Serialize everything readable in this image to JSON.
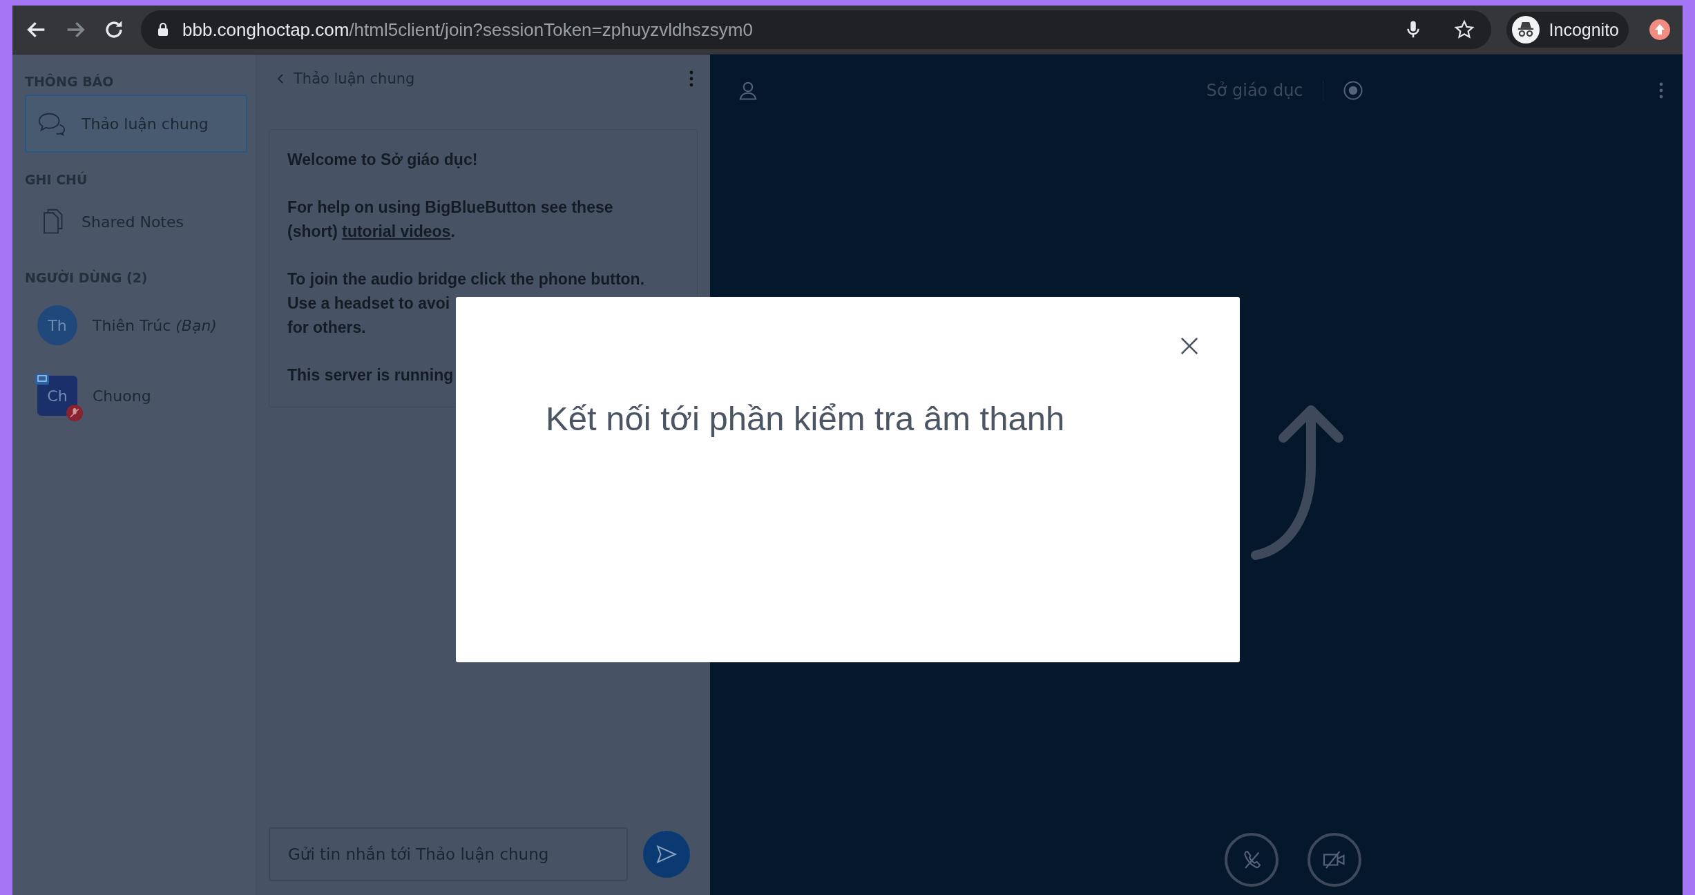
{
  "browser": {
    "url_host": "bbb.conghoctap.com",
    "url_path": "/html5client/join?sessionToken=zphuyzvldhszsym0",
    "profile": "Incognito"
  },
  "sidebar": {
    "sections": [
      {
        "title": "THÔNG BÁO",
        "items": [
          {
            "kind": "chat",
            "label": "Thảo luận chung",
            "selected": true
          }
        ]
      },
      {
        "title": "GHI CHÚ",
        "items": [
          {
            "kind": "notes",
            "label": "Shared Notes",
            "selected": false
          }
        ]
      },
      {
        "title": "NGƯỜI DÙNG (2)",
        "items": [
          {
            "kind": "user",
            "initials": "Th",
            "label": "Thiên Trúc *(Bạn)*",
            "moderator": false,
            "presenter": false,
            "muted": false,
            "selected": false
          },
          {
            "kind": "user",
            "initials": "Ch",
            "label": "Chuong",
            "moderator": true,
            "presenter": true,
            "muted": true,
            "selected": false
          }
        ]
      }
    ]
  },
  "chat": {
    "title": "Thảo luận chung",
    "welcome": [
      {
        "lines": [
          {
            "text": "Welcome to **Sở giáo dục**!"
          }
        ]
      },
      {
        "lines": [
          {
            "text": "For help on using BigBlueButton see these"
          },
          {
            "text": "(short) ",
            "link": "tutorial videos",
            "after": "."
          }
        ]
      },
      {
        "lines": [
          {
            "text": "To join the audio bridge click the phone button."
          },
          {
            "text": "Use a headset to avoi"
          },
          {
            "text": "for others."
          }
        ]
      },
      {
        "lines": [
          {
            "text": "This server is running"
          }
        ]
      }
    ],
    "placeholder": "Gửi tin nhắn tới Thảo luận chung"
  },
  "presentation": {
    "title": "Sở giáo dục"
  },
  "modal": {
    "title": "Kết nối tới phần kiểm tra âm thanh"
  }
}
